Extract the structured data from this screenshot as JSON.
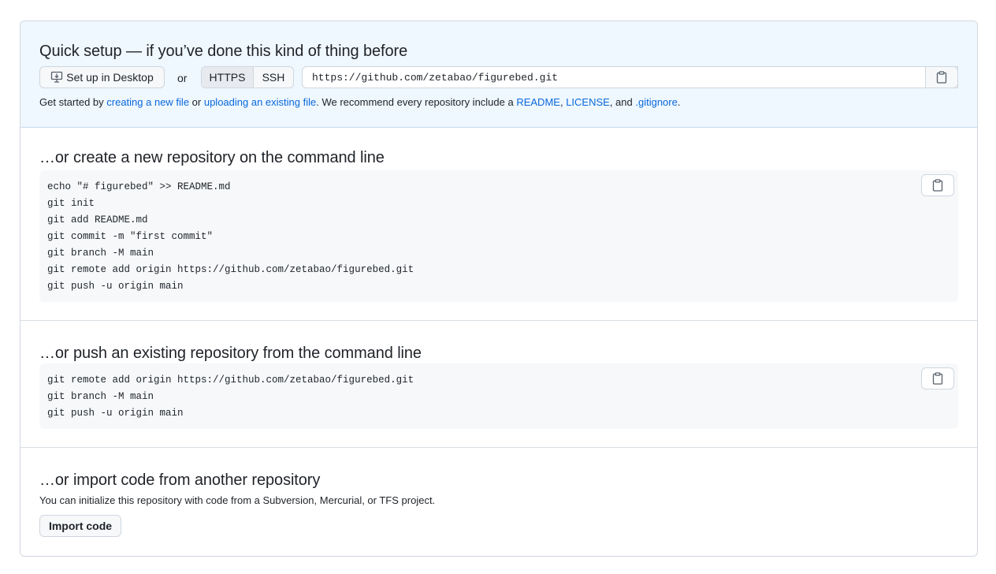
{
  "quick_setup": {
    "title": "Quick setup — if you’ve done this kind of thing before",
    "desktop_button": "Set up in Desktop",
    "or_label": "or",
    "protocols": [
      "HTTPS",
      "SSH"
    ],
    "selected_protocol": "HTTPS",
    "clone_url": "https://github.com/zetabao/figurebed.git",
    "get_started": {
      "prefix": "Get started by ",
      "link_new_file": "creating a new file",
      "or_text": " or ",
      "link_upload": "uploading an existing file",
      "recommend": ". We recommend every repository include a ",
      "link_readme": "README",
      "comma1": ", ",
      "link_license": "LICENSE",
      "and_text": ", and ",
      "link_gitignore": ".gitignore",
      "period": "."
    }
  },
  "create_repo": {
    "title": "…or create a new repository on the command line",
    "lines": [
      "echo \"# figurebed\" >> README.md",
      "git init",
      "git add README.md",
      "git commit -m \"first commit\"",
      "git branch -M main",
      "git remote add origin https://github.com/zetabao/figurebed.git",
      "git push -u origin main"
    ]
  },
  "push_repo": {
    "title": "…or push an existing repository from the command line",
    "lines": [
      "git remote add origin https://github.com/zetabao/figurebed.git",
      "git branch -M main",
      "git push -u origin main"
    ]
  },
  "import_repo": {
    "title": "…or import code from another repository",
    "description": "You can initialize this repository with code from a Subversion, Mercurial, or TFS project.",
    "button": "Import code"
  },
  "icons": {
    "desktop": "desktop-download-icon",
    "copy": "copy-clipboard-icon"
  },
  "colors": {
    "link": "#0969da",
    "quick_bg": "#eff7ff",
    "border": "#d0d7de",
    "code_bg": "#f6f8fa"
  }
}
